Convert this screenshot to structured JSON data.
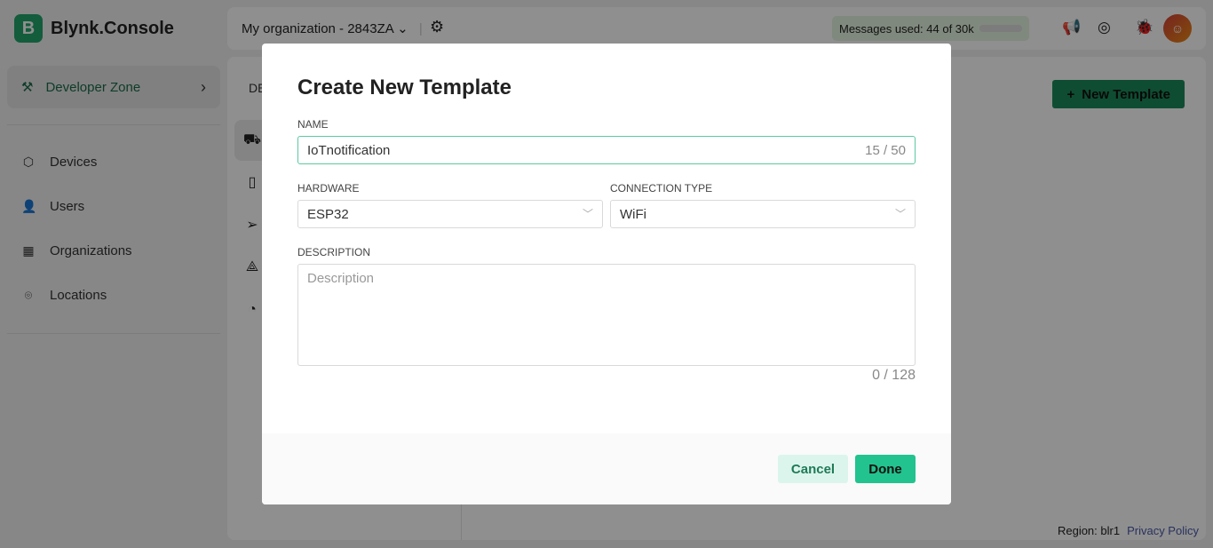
{
  "app": {
    "logo_letter": "B",
    "title": "Blynk.Console"
  },
  "sidebar": {
    "developer_zone": "Developer Zone",
    "items": [
      {
        "label": "Devices",
        "icon": "cube-icon"
      },
      {
        "label": "Users",
        "icon": "user-icon"
      },
      {
        "label": "Organizations",
        "icon": "building-icon"
      },
      {
        "label": "Locations",
        "icon": "pin-icon"
      }
    ]
  },
  "topbar": {
    "org": "My organization - 2843ZA",
    "messages": "Messages used: 44 of 30k",
    "messages_progress": 0.0015
  },
  "main": {
    "tab_head": "DE",
    "new_template": "New Template"
  },
  "footer": {
    "region": "Region: blr1",
    "privacy": "Privacy Policy"
  },
  "modal": {
    "title": "Create New Template",
    "name_label": "NAME",
    "name_value": "IoTnotification",
    "name_count": "15 / 50",
    "hardware_label": "HARDWARE",
    "hardware_value": "ESP32",
    "connection_label": "CONNECTION TYPE",
    "connection_value": "WiFi",
    "description_label": "DESCRIPTION",
    "description_placeholder": "Description",
    "description_count": "0 / 128",
    "cancel": "Cancel",
    "done": "Done"
  },
  "colors": {
    "brand": "#23a46c",
    "accent": "#22c38e"
  }
}
